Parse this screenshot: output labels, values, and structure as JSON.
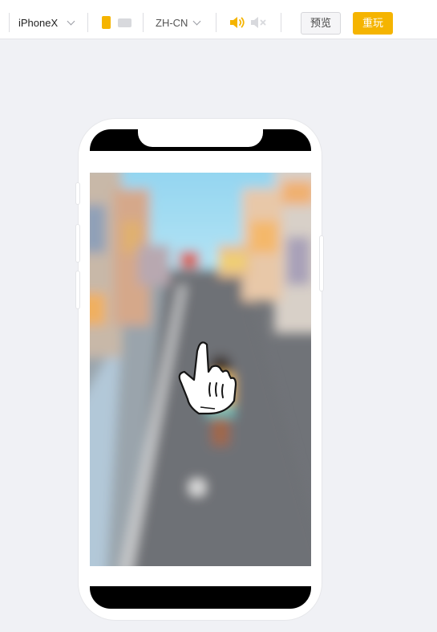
{
  "toolbar": {
    "device": {
      "label": "iPhoneX",
      "icon": "chevron-down-icon"
    },
    "orientation": {
      "selected": "portrait",
      "accent_color": "#f5b400"
    },
    "language": {
      "label": "ZH-CN",
      "icon": "chevron-down-icon"
    },
    "sound": {
      "on_icon": "speaker-on-icon",
      "off_icon": "speaker-muted-icon"
    },
    "preview_label": "预览",
    "replay_label": "重玩"
  },
  "preview": {
    "device": "iPhoneX",
    "scene": "blurred runner game street view",
    "overlay_icon": "tap-hand-icon"
  }
}
